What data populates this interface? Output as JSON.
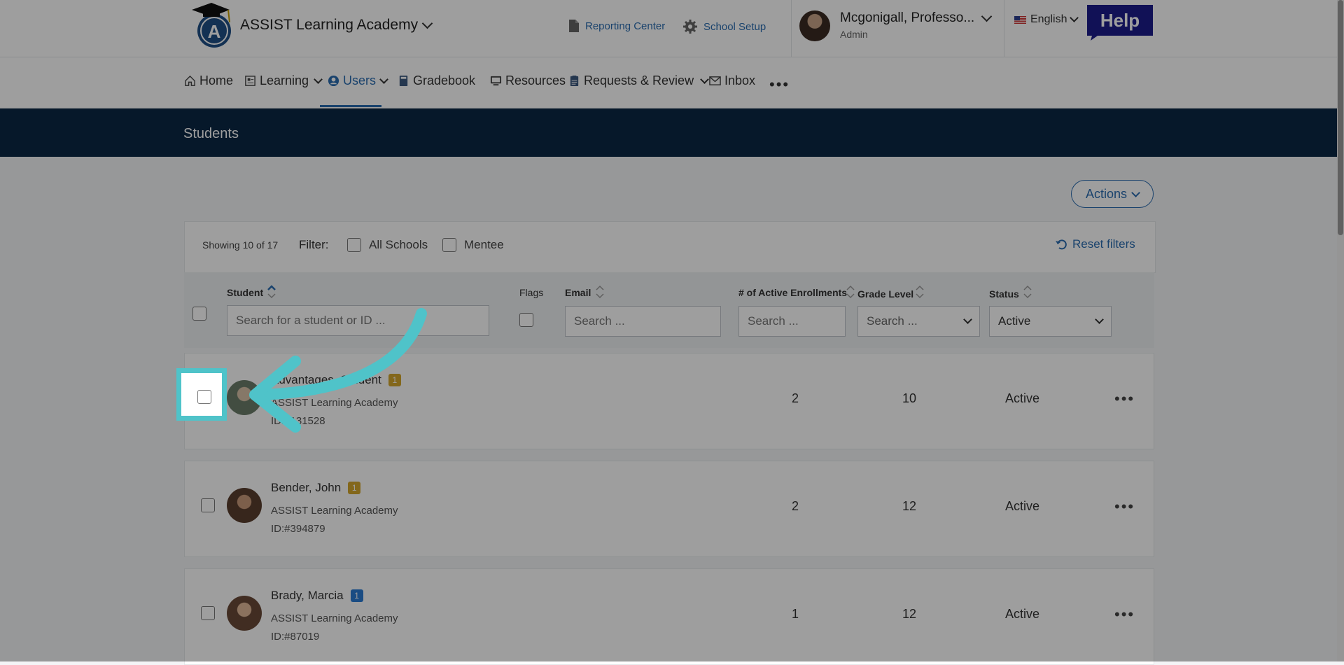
{
  "header": {
    "school_name": "ASSIST Learning Academy",
    "reporting_center": "Reporting Center",
    "school_setup": "School Setup",
    "user_name": "Mcgonigall, Professo...",
    "user_role": "Admin",
    "language": "English",
    "help": "Help"
  },
  "nav": {
    "items": [
      {
        "label": "Home",
        "icon": "home-icon"
      },
      {
        "label": "Learning",
        "icon": "learning-icon"
      },
      {
        "label": "Users",
        "icon": "user-icon",
        "active": true
      },
      {
        "label": "Gradebook",
        "icon": "book-icon"
      },
      {
        "label": "Resources",
        "icon": "monitor-icon"
      },
      {
        "label": "Requests & Review",
        "icon": "clipboard-icon"
      },
      {
        "label": "Inbox",
        "icon": "mail-icon"
      }
    ],
    "more": "•••"
  },
  "page": {
    "title": "Students",
    "actions": "Actions"
  },
  "filters": {
    "showing": "Showing 10 of 17",
    "filter_label": "Filter:",
    "all_schools": "All Schools",
    "mentee": "Mentee",
    "reset": "Reset filters"
  },
  "table": {
    "headers": {
      "student": "Student",
      "flags": "Flags",
      "email": "Email",
      "enrollments": "# of Active Enrollments",
      "grade": "Grade Level",
      "status": "Status"
    },
    "placeholders": {
      "student": "Search for a student or ID ...",
      "email": "Search ...",
      "enrollments": "Search ..."
    },
    "grade_select": "Search ...",
    "status_select": "Active",
    "rows": [
      {
        "name": "Advantages, Student",
        "badge": "1",
        "badge_color": "#d4a72c",
        "school": "ASSIST Learning Academy",
        "id": "ID:#131528",
        "enrollments": "2",
        "grade": "10",
        "status": "Active",
        "more": "•••"
      },
      {
        "name": "Bender, John",
        "badge": "1",
        "badge_color": "#d4a72c",
        "school": "ASSIST Learning Academy",
        "id": "ID:#394879",
        "enrollments": "2",
        "grade": "12",
        "status": "Active",
        "more": "•••"
      },
      {
        "name": "Brady, Marcia",
        "badge": "1",
        "badge_color": "#2b7bd4",
        "school": "ASSIST Learning Academy",
        "id": "ID:#87019",
        "enrollments": "1",
        "grade": "12",
        "status": "Active",
        "more": "•••"
      }
    ]
  },
  "colors": {
    "accent": "#2b6cb0",
    "title_band": "#0a2744",
    "highlight": "#4fc3c9"
  }
}
